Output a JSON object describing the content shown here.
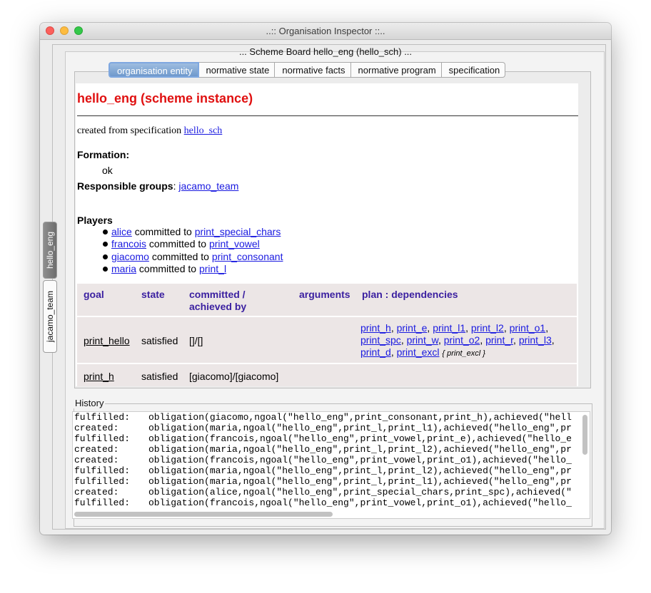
{
  "window": {
    "title": "..:: Organisation Inspector ::.."
  },
  "board": {
    "title": "... Scheme Board hello_eng (hello_sch) ..."
  },
  "side_tabs": [
    {
      "label": "hello_eng",
      "active": true
    },
    {
      "label": "jacamo_team",
      "active": false
    }
  ],
  "tabs": [
    {
      "label": "organisation entity",
      "active": true
    },
    {
      "label": "normative state",
      "active": false
    },
    {
      "label": "normative facts",
      "active": false
    },
    {
      "label": "normative program",
      "active": false
    },
    {
      "label": "specification",
      "active": false
    }
  ],
  "entity": {
    "heading": "hello_eng (scheme instance)",
    "created_from": "created from specification",
    "spec_link": "hello_sch",
    "formation_label": "Formation:",
    "formation_value": "ok",
    "resp_label": "Responsible groups",
    "resp_sep": ":",
    "resp_link": "jacamo_team",
    "players_label": "Players",
    "players": [
      {
        "agent": "alice",
        "text": "committed to",
        "goal": "print_special_chars"
      },
      {
        "agent": "francois",
        "text": "committed to",
        "goal": "print_vowel"
      },
      {
        "agent": "giacomo",
        "text": "committed to",
        "goal": "print_consonant"
      },
      {
        "agent": "maria",
        "text": "committed to",
        "goal": "print_l"
      }
    ]
  },
  "goals_table": {
    "headers": {
      "goal": "goal",
      "state": "state",
      "committed_1": "committed /",
      "committed_2": "achieved by",
      "arguments": "arguments",
      "plan": "plan : dependencies"
    },
    "rows": [
      {
        "goal": "print_hello",
        "state": "satisfied",
        "committed": "[]/[]",
        "arguments": "",
        "deps": [
          "print_h",
          "print_e",
          "print_l1",
          "print_l2",
          "print_o1",
          "print_spc",
          "print_w",
          "print_o2",
          "print_r",
          "print_l3",
          "print_d",
          "print_excl"
        ],
        "deps_note": "{ print_excl }"
      },
      {
        "goal": "print_h",
        "state": "satisfied",
        "committed": "[giacomo]/[giacomo]",
        "arguments": "",
        "deps": [],
        "deps_note": ""
      }
    ]
  },
  "history": {
    "label": "History",
    "lines": [
      {
        "kind": "fulfilled:",
        "text": "obligation(giacomo,ngoal(\"hello_eng\",print_consonant,print_h),achieved(\"hell"
      },
      {
        "kind": "created:",
        "text": "obligation(maria,ngoal(\"hello_eng\",print_l,print_l1),achieved(\"hello_eng\",pr"
      },
      {
        "kind": "fulfilled:",
        "text": "obligation(francois,ngoal(\"hello_eng\",print_vowel,print_e),achieved(\"hello_e"
      },
      {
        "kind": "created:",
        "text": "obligation(maria,ngoal(\"hello_eng\",print_l,print_l2),achieved(\"hello_eng\",pr"
      },
      {
        "kind": "created:",
        "text": "obligation(francois,ngoal(\"hello_eng\",print_vowel,print_o1),achieved(\"hello_"
      },
      {
        "kind": "fulfilled:",
        "text": "obligation(maria,ngoal(\"hello_eng\",print_l,print_l2),achieved(\"hello_eng\",pr"
      },
      {
        "kind": "fulfilled:",
        "text": "obligation(maria,ngoal(\"hello_eng\",print_l,print_l1),achieved(\"hello_eng\",pr"
      },
      {
        "kind": "created:",
        "text": "obligation(alice,ngoal(\"hello_eng\",print_special_chars,print_spc),achieved(\""
      },
      {
        "kind": "fulfilled:",
        "text": "obligation(francois,ngoal(\"hello_eng\",print_vowel,print_o1),achieved(\"hello_"
      }
    ]
  },
  "colors": {
    "heading": "#e01010",
    "link": "#1a1ae0",
    "table_header": "#3a1fa0",
    "table_bg": "#ece6e6",
    "tab_active": "#6f99cc"
  }
}
